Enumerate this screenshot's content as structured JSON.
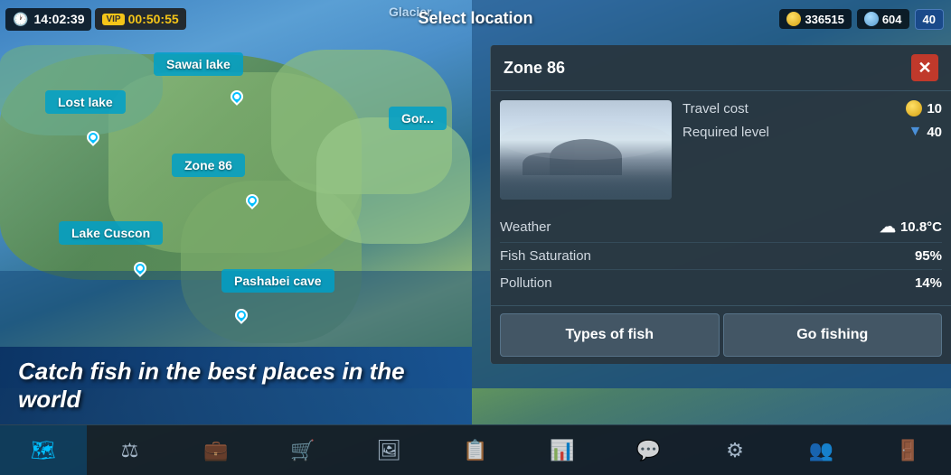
{
  "header": {
    "time": "14:02:39",
    "vip_label": "VIP",
    "vip_timer": "00:50:55",
    "select_location": "Select location",
    "coins": "336515",
    "gems": "604",
    "level": "40"
  },
  "map": {
    "glacier_label": "Glacier",
    "locations": [
      {
        "id": "sawai-lake",
        "label": "Sawai lake"
      },
      {
        "id": "lost-lake",
        "label": "Lost lake"
      },
      {
        "id": "zone-86",
        "label": "Zone 86"
      },
      {
        "id": "lake-cuscon",
        "label": "Lake Cuscon"
      },
      {
        "id": "pashabei-cave",
        "label": "Pashabei cave"
      },
      {
        "id": "gor",
        "label": "Gor..."
      }
    ]
  },
  "zone_panel": {
    "title": "Zone 86",
    "travel_cost_label": "Travel cost",
    "travel_cost_value": "10",
    "required_level_label": "Required level",
    "required_level_value": "40",
    "weather_label": "Weather",
    "weather_value": "10.8°C",
    "fish_saturation_label": "Fish Saturation",
    "fish_saturation_value": "95%",
    "pollution_label": "Pollution",
    "pollution_value": "14%",
    "types_of_fish_btn": "Types of fish",
    "go_fishing_btn": "Go fishing",
    "close_label": "✕"
  },
  "banner": {
    "text": "Catch fish in the best places in the world"
  },
  "nav": {
    "items": [
      {
        "id": "map",
        "icon": "🗺",
        "label": "Map"
      },
      {
        "id": "balance",
        "icon": "⚖",
        "label": "Balance"
      },
      {
        "id": "tackle",
        "icon": "💼",
        "label": "Tackle"
      },
      {
        "id": "shop",
        "icon": "🛒",
        "label": "Shop"
      },
      {
        "id": "gallery",
        "icon": "🖼",
        "label": "Gallery"
      },
      {
        "id": "tasks",
        "icon": "📋",
        "label": "Tasks"
      },
      {
        "id": "stats",
        "icon": "📊",
        "label": "Stats"
      },
      {
        "id": "chat",
        "icon": "💬",
        "label": "Chat"
      },
      {
        "id": "settings",
        "icon": "⚙",
        "label": "Settings"
      },
      {
        "id": "friends",
        "icon": "👥",
        "label": "Friends"
      },
      {
        "id": "exit",
        "icon": "🚪",
        "label": "Exit"
      }
    ]
  }
}
